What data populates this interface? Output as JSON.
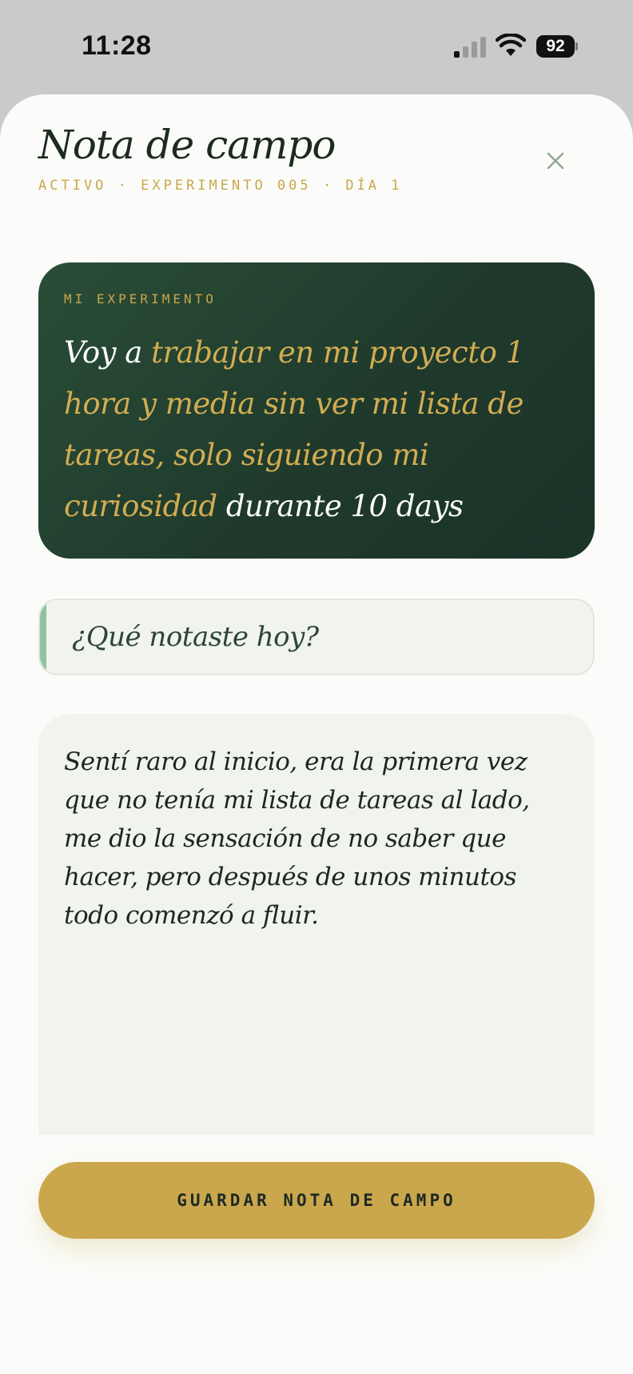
{
  "status_bar": {
    "time": "11:28",
    "battery": "92",
    "signal_icon": "cellular-signal-icon",
    "wifi_icon": "wifi-icon"
  },
  "header": {
    "title": "Nota de campo",
    "subtitle": "ACTIVO · EXPERIMENTO 005 · DÍA 1",
    "close_icon": "close-icon"
  },
  "experiment": {
    "label": "MI EXPERIMENTO",
    "prefix": "Voy a ",
    "action": "trabajar en mi proyecto 1 hora y media sin ver mi lista de tareas, solo siguiendo mi curiosidad",
    "suffix": " durante 10 days"
  },
  "prompt": {
    "text": "¿Qué notaste hoy?"
  },
  "note": {
    "value": "Sentí raro al inicio, era la primera vez que no tenía mi lista de tareas al lado, me dio la sensación de no saber que hacer, pero después de unos minutos todo comenzó a fluir."
  },
  "actions": {
    "save_label": "GUARDAR NOTA DE CAMPO"
  },
  "colors": {
    "accent_gold": "#caa74c",
    "card_green": "#1f3a2c",
    "prompt_bar": "#8fc2a2"
  }
}
